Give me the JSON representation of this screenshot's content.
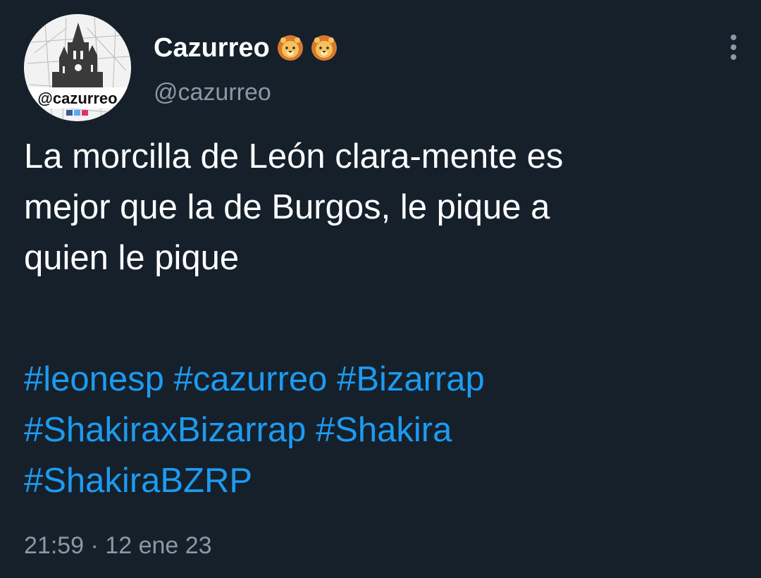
{
  "tweet": {
    "author": {
      "display_name": "Cazurreo",
      "name_emojis": [
        "lion-face-icon",
        "lion-face-icon"
      ],
      "handle": "@cazurreo",
      "avatar_label": "@cazurreo"
    },
    "text_lines": [
      "La morcilla de León clara-mente es",
      "mejor que la de Burgos, le pique a",
      "quien le pique"
    ],
    "hashtag_lines": [
      [
        "#leonesp",
        "#cazurreo",
        "#Bizarrap"
      ],
      [
        "#ShakiraxBizarrap",
        "#Shakira"
      ],
      [
        "#ShakiraBZRP"
      ]
    ],
    "timestamp": "21:59 · 12 ene 23"
  },
  "colors": {
    "background": "#15202b",
    "primary_text": "#ffffff",
    "secondary_text": "#8b98a5",
    "hashtag": "#1d9bf0"
  },
  "icons": {
    "more_options": "more-options-icon"
  }
}
